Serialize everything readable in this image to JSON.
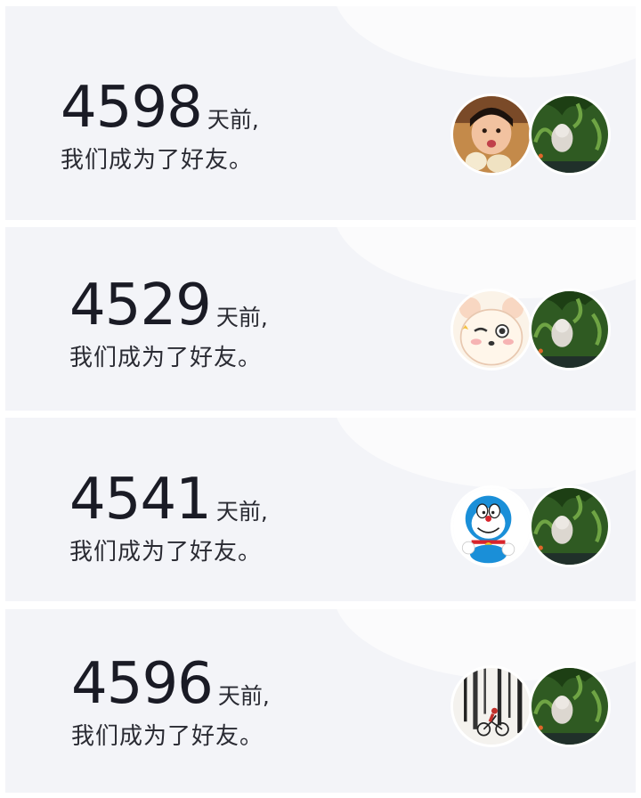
{
  "cards": [
    {
      "days": "4598",
      "suffix": "天前,",
      "message": "我们成为了好友。",
      "friend_avatar": "child-photo",
      "my_avatar": "plant-photo"
    },
    {
      "days": "4529",
      "suffix": "天前,",
      "message": "我们成为了好友。",
      "friend_avatar": "cartoon-bear",
      "my_avatar": "plant-photo"
    },
    {
      "days": "4541",
      "suffix": "天前,",
      "message": "我们成为了好友。",
      "friend_avatar": "doraemon",
      "my_avatar": "plant-photo"
    },
    {
      "days": "4596",
      "suffix": "天前,",
      "message": "我们成为了好友。",
      "friend_avatar": "cyclist-illustration",
      "my_avatar": "plant-photo"
    }
  ],
  "colors": {
    "card_bg": "#f3f4f8",
    "text_dark": "#1a1b25",
    "page_bg": "#ffffff"
  }
}
